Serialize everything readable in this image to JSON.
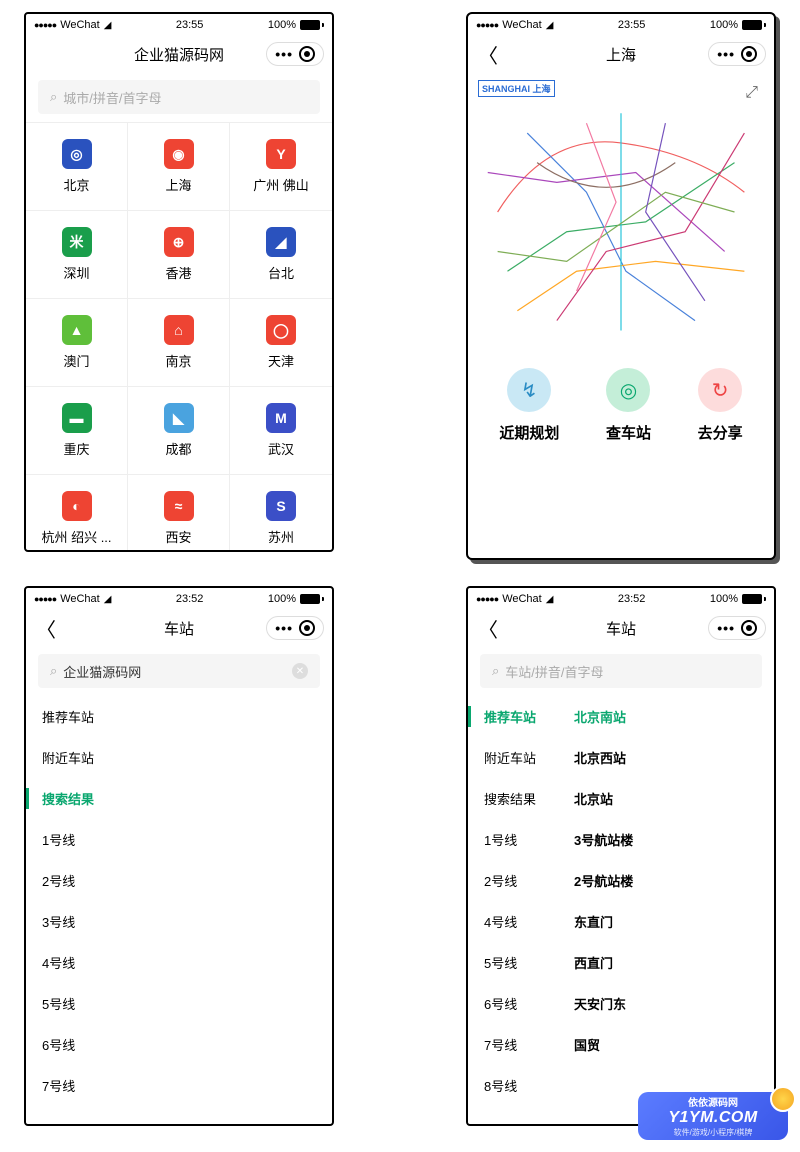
{
  "status": {
    "carrier": "WeChat",
    "dots": "●●●●●",
    "battery_pct": "100%"
  },
  "times": {
    "s1": "23:55",
    "s2": "23:55",
    "s3": "23:52",
    "s4": "23:52"
  },
  "screen1": {
    "title": "企业猫源码网",
    "search_placeholder": "城市/拼音/首字母",
    "cities": [
      {
        "name": "北京",
        "bg": "#2a52be",
        "glyph": "◎"
      },
      {
        "name": "上海",
        "bg": "#e43",
        "glyph": "◉"
      },
      {
        "name": "广州 佛山",
        "bg": "#e43",
        "glyph": "Y"
      },
      {
        "name": "深圳",
        "bg": "#1a9e4b",
        "glyph": "米"
      },
      {
        "name": "香港",
        "bg": "#e43",
        "glyph": "⊕"
      },
      {
        "name": "台北",
        "bg": "#2a52be",
        "glyph": "◢"
      },
      {
        "name": "澳门",
        "bg": "#5fbf3a",
        "glyph": "▲"
      },
      {
        "name": "南京",
        "bg": "#e43",
        "glyph": "⌂"
      },
      {
        "name": "天津",
        "bg": "#e43",
        "glyph": "◯"
      },
      {
        "name": "重庆",
        "bg": "#1a9e4b",
        "glyph": "▬"
      },
      {
        "name": "成都",
        "bg": "#4aa3df",
        "glyph": "◣"
      },
      {
        "name": "武汉",
        "bg": "#3b4fc7",
        "glyph": "M"
      },
      {
        "name": "杭州 绍兴 ...",
        "bg": "#e43",
        "glyph": "◐"
      },
      {
        "name": "西安",
        "bg": "#e43",
        "glyph": "≈"
      },
      {
        "name": "苏州",
        "bg": "#3b4fc7",
        "glyph": "S"
      }
    ]
  },
  "screen2": {
    "title": "上海",
    "map_label": "SHANGHAI 上海",
    "expand_icon": "⤢",
    "actions": [
      {
        "label": "近期规划",
        "bg": "#c9e8f5",
        "color": "#2a8cc4",
        "glyph": "↯"
      },
      {
        "label": "查车站",
        "bg": "#c4eed8",
        "color": "#0aa76f",
        "glyph": "◎"
      },
      {
        "label": "去分享",
        "bg": "#fddcdc",
        "color": "#e44",
        "glyph": "↻"
      }
    ]
  },
  "screen3": {
    "title": "车站",
    "search_text": "企业猫源码网",
    "items": [
      {
        "label": "推荐车站",
        "active": false
      },
      {
        "label": "附近车站",
        "active": false
      },
      {
        "label": "搜索结果",
        "active": true
      },
      {
        "label": "1号线",
        "active": false
      },
      {
        "label": "2号线",
        "active": false
      },
      {
        "label": "3号线",
        "active": false
      },
      {
        "label": "4号线",
        "active": false
      },
      {
        "label": "5号线",
        "active": false
      },
      {
        "label": "6号线",
        "active": false
      },
      {
        "label": "7号线",
        "active": false
      }
    ]
  },
  "screen4": {
    "title": "车站",
    "search_placeholder": "车站/拼音/首字母",
    "rows": [
      {
        "left": "推荐车站",
        "right": "北京南站",
        "active": true
      },
      {
        "left": "附近车站",
        "right": "北京西站",
        "active": false
      },
      {
        "left": "搜索结果",
        "right": "北京站",
        "active": false
      },
      {
        "left": "1号线",
        "right": "3号航站楼",
        "active": false
      },
      {
        "left": "2号线",
        "right": "2号航站楼",
        "active": false
      },
      {
        "left": "4号线",
        "right": "东直门",
        "active": false
      },
      {
        "left": "5号线",
        "right": "西直门",
        "active": false
      },
      {
        "left": "6号线",
        "right": "天安门东",
        "active": false
      },
      {
        "left": "7号线",
        "right": "国贸",
        "active": false
      },
      {
        "left": "8号线",
        "right": "",
        "active": false
      }
    ]
  },
  "watermark": {
    "title": "依依源码网",
    "url": "Y1YM.COM",
    "sub": "软件/游戏/小程序/棋牌"
  }
}
